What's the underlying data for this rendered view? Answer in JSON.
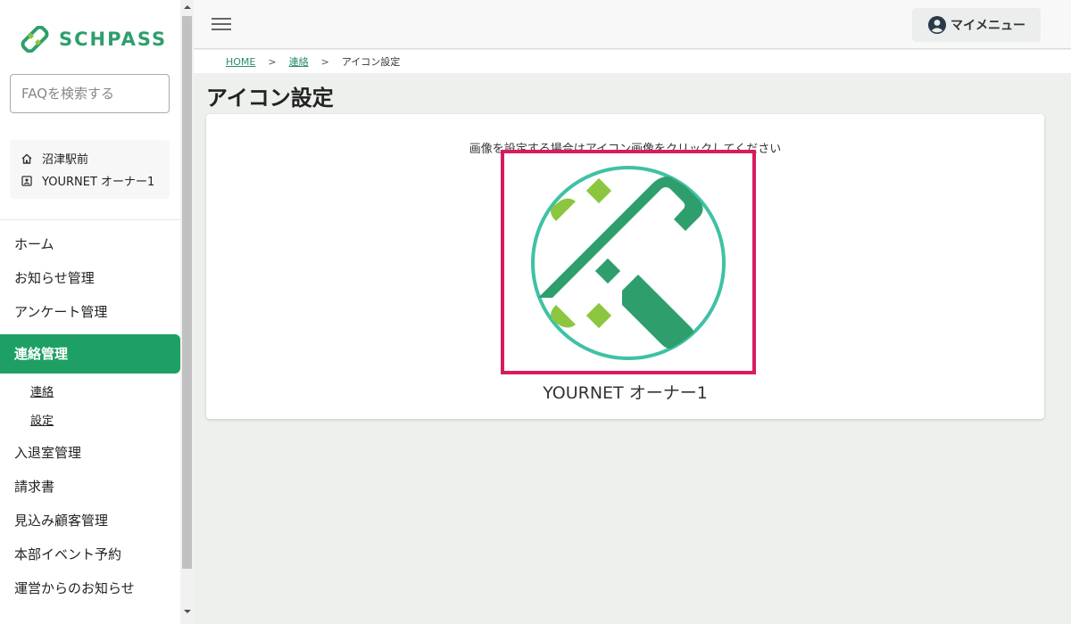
{
  "brand": {
    "name": "SCHPASS",
    "color": "#2e9e6d"
  },
  "sidebar": {
    "search_placeholder": "FAQを検索する",
    "store": {
      "location": "沼津駅前",
      "owner": "YOURNET オーナー1"
    },
    "items": [
      {
        "label": "ホーム"
      },
      {
        "label": "お知らせ管理"
      },
      {
        "label": "アンケート管理"
      },
      {
        "label": "連絡管理",
        "active": true
      },
      {
        "label": "入退室管理"
      },
      {
        "label": "請求書"
      },
      {
        "label": "見込み顧客管理"
      },
      {
        "label": "本部イベント予約"
      },
      {
        "label": "運営からのお知らせ"
      }
    ],
    "subitems": [
      {
        "label": "連絡"
      },
      {
        "label": "設定"
      }
    ],
    "active_color": "#1ea064"
  },
  "header": {
    "my_menu_label": "マイメニュー"
  },
  "breadcrumb": {
    "home": "HOME",
    "parent": "連絡",
    "current": "アイコン設定",
    "separator": ">"
  },
  "page": {
    "title": "アイコン設定",
    "instruction": "画像を設定する場合はアイコン画像をクリックしてください",
    "owner_name": "YOURNET オーナー1",
    "frame_color": "#d81b60"
  }
}
